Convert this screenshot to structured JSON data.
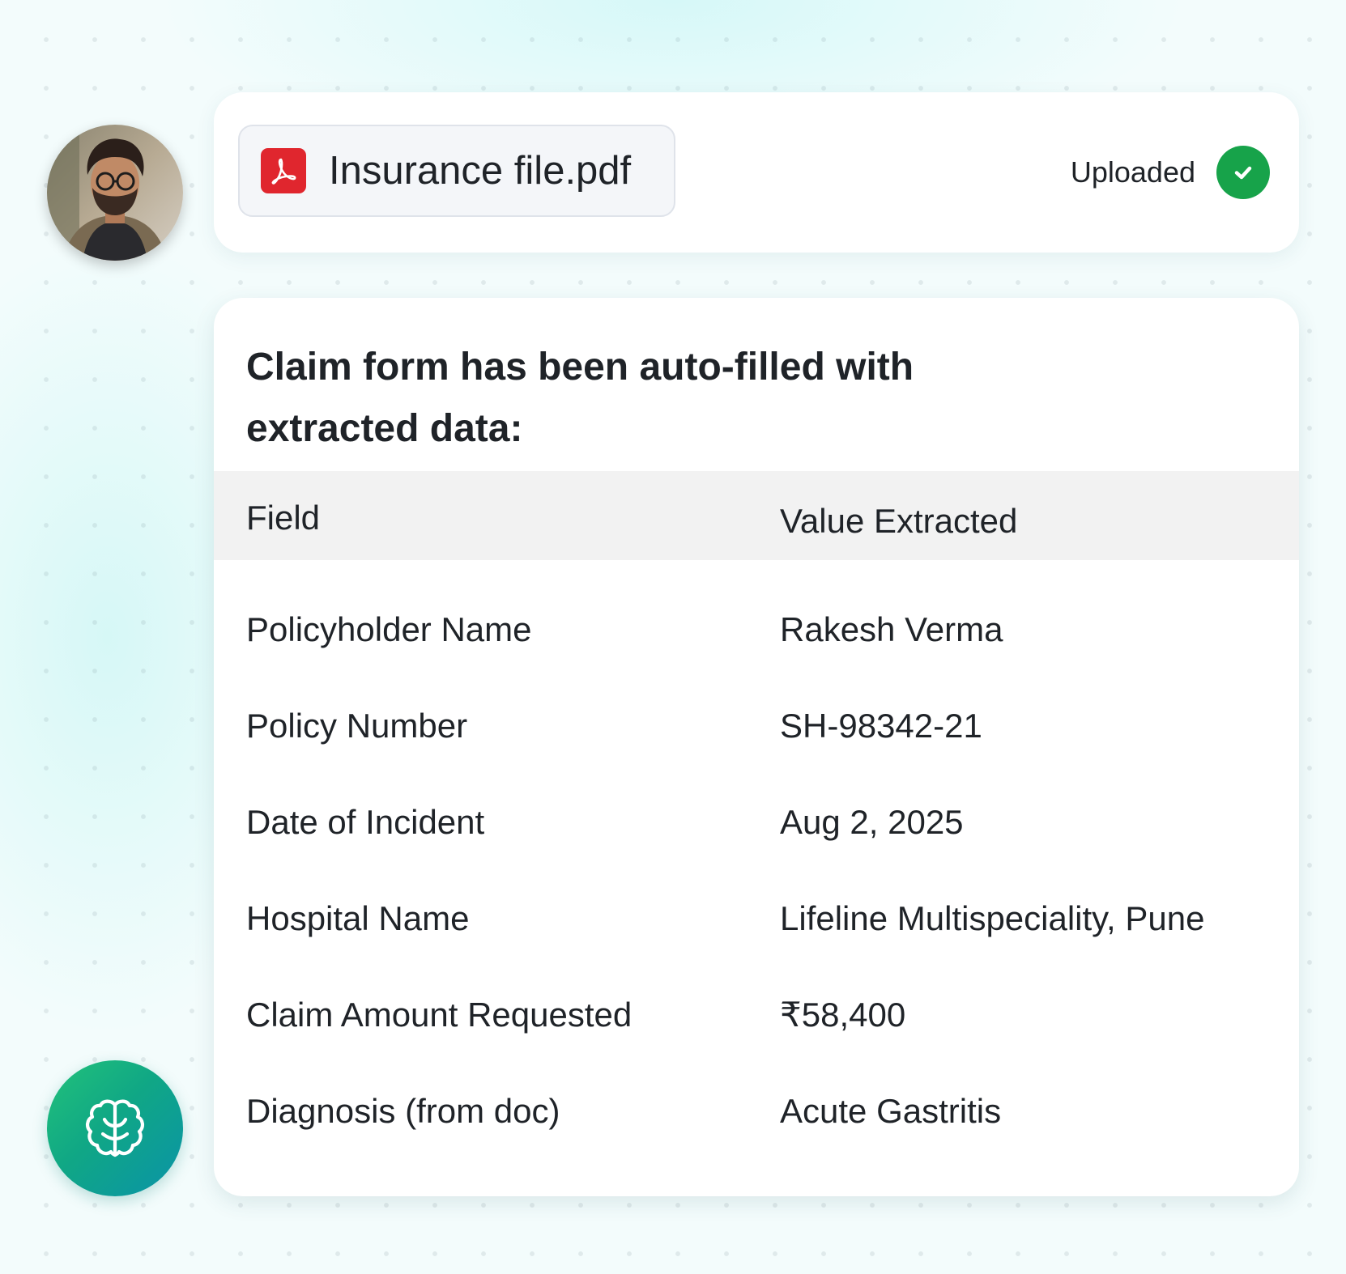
{
  "upload": {
    "file_name": "Insurance file.pdf",
    "file_icon": "pdf-icon",
    "status_label": "Uploaded",
    "status_icon": "check-circle-icon",
    "status_color": "#17a34a",
    "file_icon_color": "#e0262e"
  },
  "claim": {
    "title": "Claim form has been auto-filled with extracted data:",
    "columns": [
      "Field",
      "Value Extracted"
    ],
    "rows": [
      {
        "field": "Policyholder Name",
        "value": "Rakesh Verma"
      },
      {
        "field": "Policy Number",
        "value": "SH-98342-21"
      },
      {
        "field": "Date of Incident",
        "value": "Aug 2, 2025"
      },
      {
        "field": "Hospital Name",
        "value": "Lifeline Multispeciality, Pune"
      },
      {
        "field": "Claim Amount Requested",
        "value": "₹58,400"
      },
      {
        "field": "Diagnosis (from doc)",
        "value": "Acute Gastritis"
      }
    ]
  },
  "assistant": {
    "icon": "brain-icon",
    "accent_start": "#22c27a",
    "accent_end": "#0a93a8"
  },
  "user": {
    "avatar_icon": "user-avatar"
  }
}
